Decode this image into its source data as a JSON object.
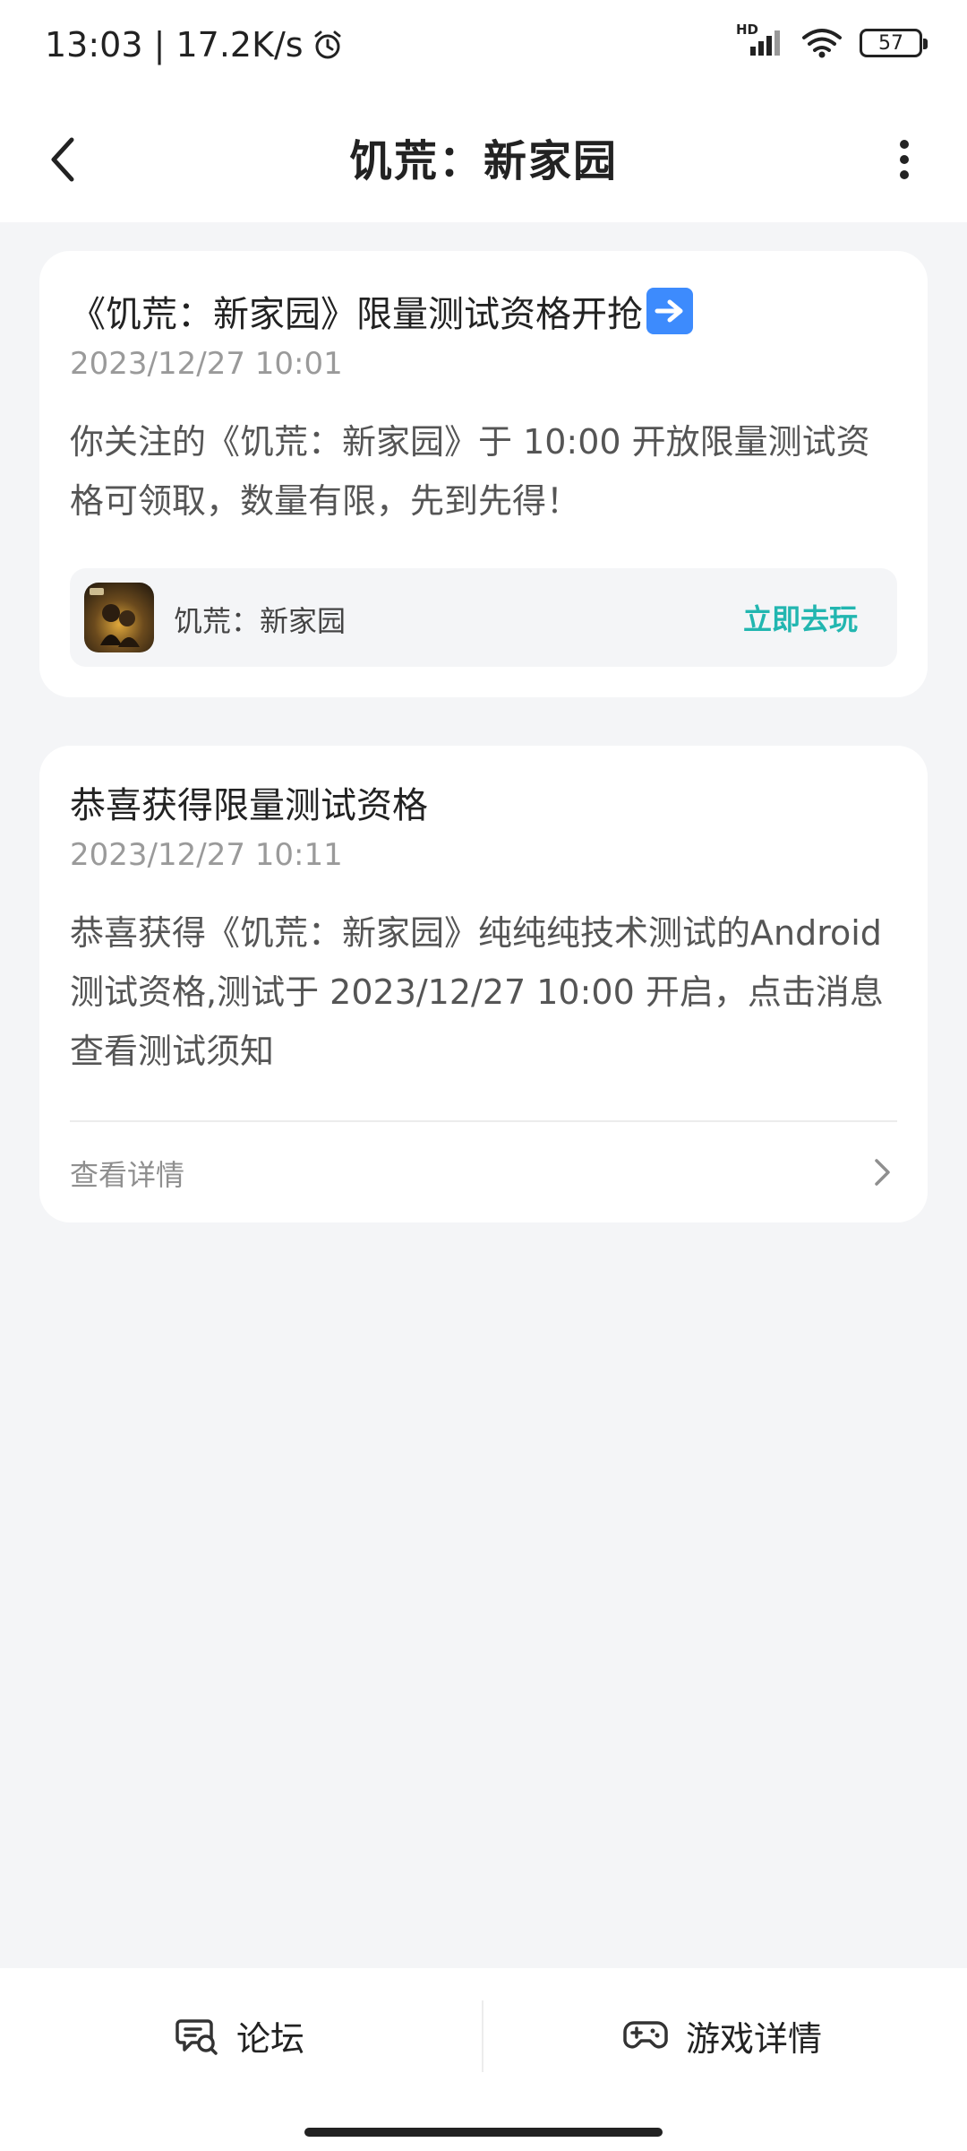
{
  "status_bar": {
    "time_speed": "13:03 | 17.2K/s",
    "network_label": "HD",
    "battery": "57",
    "icons": [
      "alarm-icon",
      "signal-icon",
      "wifi-icon",
      "battery-icon"
    ]
  },
  "header": {
    "title": "饥荒：新家园",
    "icons": [
      "back-chevron-icon",
      "more-vertical-icon"
    ]
  },
  "cards": [
    {
      "title": "《饥荒：新家园》限量测试资格开抢",
      "title_emoji": "right-arrow-emoji",
      "time": "2023/12/27 10:01",
      "body": "你关注的《饥荒：新家园》于 10:00 开放限量测试资格可领取，数量有限，先到先得！",
      "game": {
        "name": "饥荒：新家园",
        "action": "立即去玩"
      }
    },
    {
      "title": "恭喜获得限量测试资格",
      "time": "2023/12/27 10:11",
      "body": "恭喜获得《饥荒：新家园》纯纯纯技术测试的Android测试资格,测试于 2023/12/27 10:00 开启，点击消息查看测试须知",
      "link": "查看详情"
    }
  ],
  "bottom_bar": {
    "forum": "论坛",
    "game_detail": "游戏详情",
    "icons": [
      "forum-chat-icon",
      "gamepad-icon"
    ]
  },
  "colors": {
    "accent": "#22b6b0",
    "background": "#f4f5f7",
    "card": "#ffffff",
    "muted_text": "#9a9a9a"
  }
}
